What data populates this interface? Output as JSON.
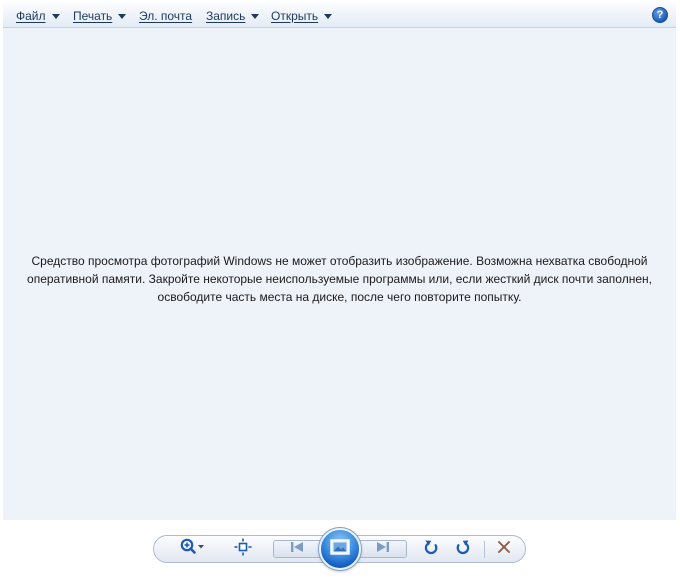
{
  "menu": {
    "file": "Файл",
    "print": "Печать",
    "email": "Эл. почта",
    "burn": "Запись",
    "open": "Открыть",
    "help_glyph": "?"
  },
  "message": {
    "line1": "Средство просмотра фотографий Windows не может отобразить изображение. Возможна нехватка свободной",
    "line2": "оперативной памяти. Закройте некоторые неиспользуемые программы или, если жесткий диск почти заполнен,",
    "line3": "освободите часть места на диске, после чего повторите попытку."
  },
  "toolbar": {
    "icons": [
      "zoom-icon",
      "actual-size-icon",
      "previous-icon",
      "slideshow-icon",
      "next-icon",
      "rotate-counterclockwise-icon",
      "rotate-clockwise-icon",
      "delete-icon"
    ]
  },
  "colors": {
    "accent": "#1d5bb8",
    "viewer_background": "#eef2f9",
    "menu_text": "#1e395b",
    "delete_icon": "#8a5a3a"
  }
}
